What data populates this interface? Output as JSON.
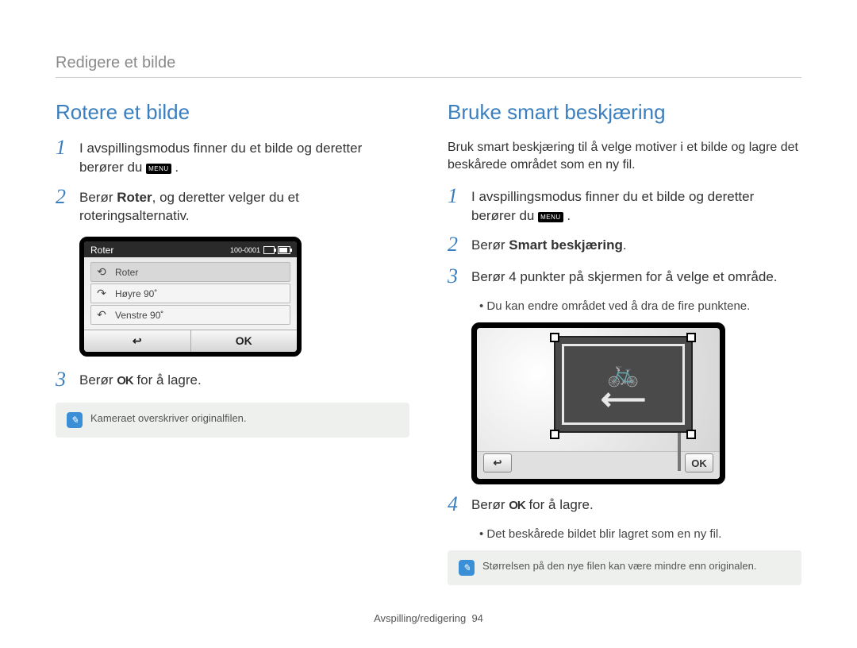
{
  "breadcrumb": "Redigere et bilde",
  "left": {
    "heading": "Rotere et bilde",
    "step1": "I avspillingsmodus finner du et bilde og deretter berører du",
    "step1_tail": ".",
    "menu_label": "MENU",
    "step2_a": "Berør ",
    "step2_b": "Roter",
    "step2_c": ", og deretter velger du et roteringsalternativ.",
    "device": {
      "title": "Roter",
      "file_index": "100-0001",
      "item1": "Roter",
      "item2": "Høyre 90˚",
      "item3": "Venstre 90˚",
      "back": "↩",
      "ok": "OK"
    },
    "step3_a": "Berør ",
    "step3_ok": "OK",
    "step3_b": " for å lagre.",
    "note": "Kameraet overskriver originalfilen."
  },
  "right": {
    "heading": "Bruke smart beskjæring",
    "intro": "Bruk smart beskjæring til å velge motiver i et bilde og lagre det beskårede området som en ny fil.",
    "step1": "I avspillingsmodus finner du et bilde og deretter berører du",
    "step1_tail": ".",
    "menu_label": "MENU",
    "step2_a": "Berør ",
    "step2_b": "Smart beskjæring",
    "step2_c": ".",
    "step3": "Berør 4 punkter på skjermen for å velge et område.",
    "bullet3": "Du kan endre området ved å dra de fire punktene.",
    "crop": {
      "back": "↩",
      "ok": "OK"
    },
    "step4_a": "Berør ",
    "step4_ok": "OK",
    "step4_b": " for å lagre.",
    "bullet4": "Det beskårede bildet blir lagret som en ny fil.",
    "note": "Størrelsen på den nye filen kan være mindre enn originalen."
  },
  "footer": {
    "section": "Avspilling/redigering",
    "page": "94"
  }
}
